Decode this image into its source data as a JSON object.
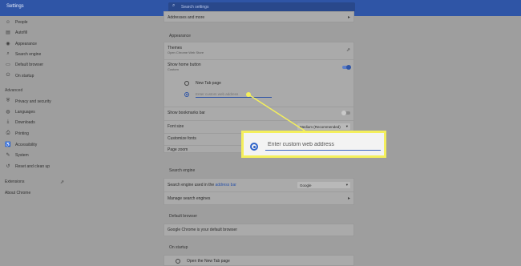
{
  "app": {
    "title": "Settings"
  },
  "search": {
    "placeholder": "Search settings"
  },
  "sidebar": {
    "items": [
      {
        "label": "People",
        "icon": "person-icon"
      },
      {
        "label": "Autofill",
        "icon": "autofill-icon"
      },
      {
        "label": "Appearance",
        "icon": "palette-icon"
      },
      {
        "label": "Search engine",
        "icon": "search-icon"
      },
      {
        "label": "Default browser",
        "icon": "browser-icon"
      },
      {
        "label": "On startup",
        "icon": "power-icon"
      }
    ],
    "advanced": "Advanced",
    "advanced_items": [
      {
        "label": "Privacy and security",
        "icon": "shield-icon"
      },
      {
        "label": "Languages",
        "icon": "globe-icon"
      },
      {
        "label": "Downloads",
        "icon": "download-icon"
      },
      {
        "label": "Printing",
        "icon": "printer-icon"
      },
      {
        "label": "Accessibility",
        "icon": "accessibility-icon"
      },
      {
        "label": "System",
        "icon": "wrench-icon"
      },
      {
        "label": "Reset and clean up",
        "icon": "reset-icon"
      }
    ],
    "extensions": "Extensions",
    "about": "About Chrome"
  },
  "top_card": {
    "addresses": "Addresses and more"
  },
  "appearance": {
    "title": "Appearance",
    "themes": "Themes",
    "themes_sub": "Open Chrome Web Store",
    "home_button": "Show home button",
    "home_button_sub": "Custom",
    "home_button_on": true,
    "new_tab": "New Tab page",
    "custom_placeholder": "Enter custom web address",
    "bookmarks_bar": "Show bookmarks bar",
    "bookmarks_on": false,
    "font_size": "Font size",
    "font_size_value": "Medium (Recommended)",
    "customize_fonts": "Customize fonts",
    "page_zoom": "Page zoom"
  },
  "search_engine": {
    "title": "Search engine",
    "used_prefix": "Search engine used in the",
    "address_bar": "address bar",
    "value": "Google",
    "manage": "Manage search engines"
  },
  "default_browser": {
    "title": "Default browser",
    "text": "Google Chrome is your default browser"
  },
  "on_startup": {
    "title": "On startup",
    "option": "Open the New Tab page"
  },
  "callout": {
    "placeholder": "Enter custom web address"
  },
  "colors": {
    "header": "#2f55a6",
    "callout_border": "#f4ef5c",
    "accent": "#2f63c9"
  }
}
